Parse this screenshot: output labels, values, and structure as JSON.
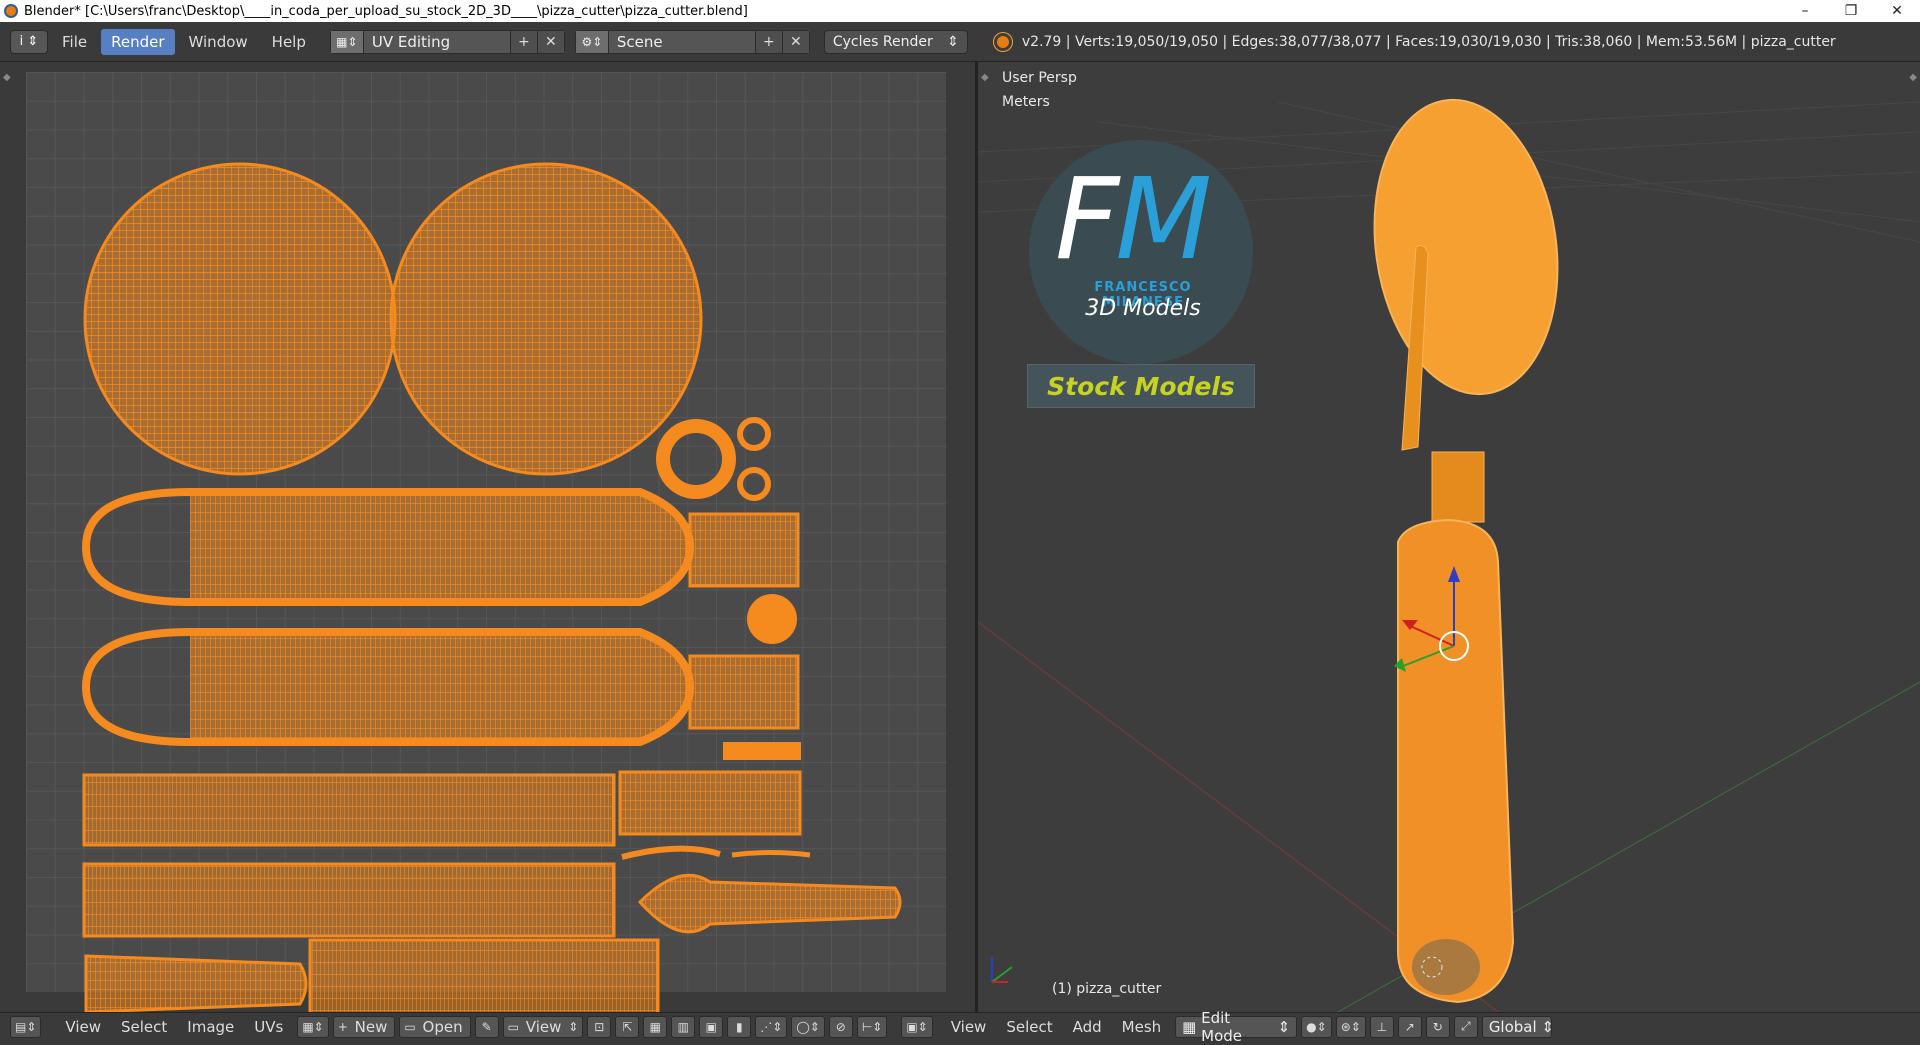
{
  "window": {
    "title": "Blender* [C:\\Users\\franc\\Desktop\\____in_coda_per_upload_su_stock_2D_3D____\\pizza_cutter\\pizza_cutter.blend]",
    "minimize": "–",
    "restore": "❐",
    "close": "✕"
  },
  "header": {
    "info_icon": "i",
    "menus": [
      "File",
      "Render",
      "Window",
      "Help"
    ],
    "active_menu": "Render",
    "screen_layout": "UV Editing",
    "scene": "Scene",
    "render_engine": "Cycles Render",
    "stats": "v2.79 | Verts:19,050/19,050 | Edges:38,077/38,077 | Faces:19,030/19,030 | Tris:38,060 | Mem:53.56M | pizza_cutter"
  },
  "viewport": {
    "view_name": "User Persp",
    "units": "Meters",
    "object_label": "(1) pizza_cutter"
  },
  "watermark": {
    "letter1": "F",
    "letter2": "M",
    "name": "FRANCESCO MILANESE",
    "tagline": "3D Models",
    "badge": "Stock Models"
  },
  "uv_footer": {
    "menus": [
      "View",
      "Select",
      "Image",
      "UVs"
    ],
    "new_label": "New",
    "open_label": "Open",
    "view_label": "View"
  },
  "view_footer": {
    "menus": [
      "View",
      "Select",
      "Add",
      "Mesh"
    ],
    "mode": "Edit Mode",
    "orientation": "Global"
  },
  "colors": {
    "mesh": "#f58a1f",
    "accent": "#5680c2"
  }
}
